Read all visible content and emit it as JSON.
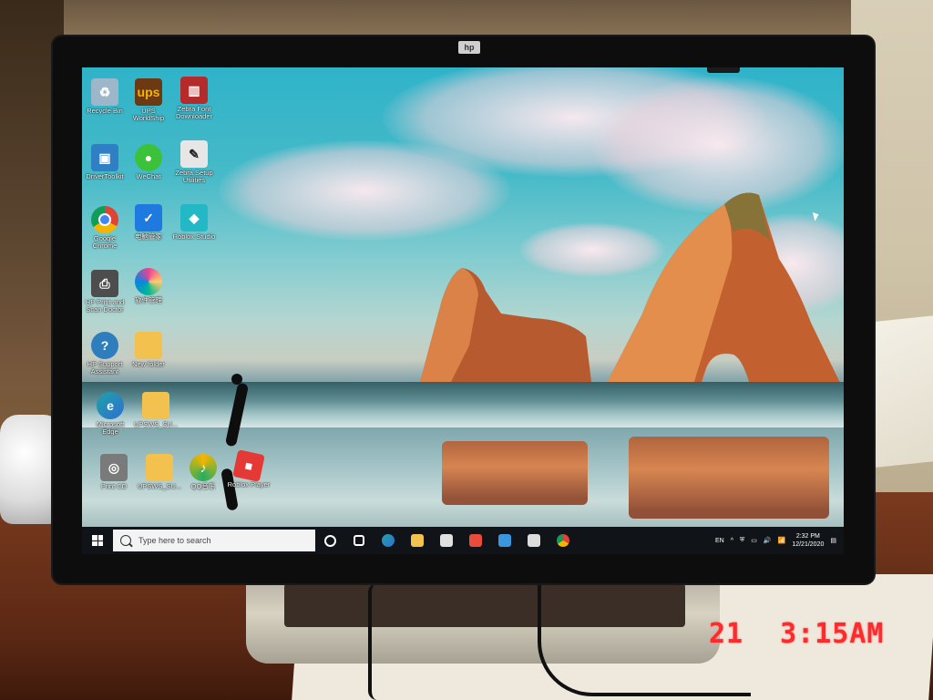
{
  "monitor": {
    "brand": "hp"
  },
  "photo_overlay": {
    "date_fragment": "21",
    "time": "3:15AM"
  },
  "desktop_icons": [
    {
      "label": "Recycle Bin",
      "icon": "recycle-bin-icon",
      "color": "#9bb7c9"
    },
    {
      "label": "UPS WorldShip",
      "icon": "ups-icon",
      "color": "#6b3a12"
    },
    {
      "label": "Zebra Font Downloader",
      "icon": "zebra-font-icon",
      "color": "#b52a2a"
    },
    {
      "label": "DriverToolkit",
      "icon": "driver-toolkit-icon",
      "color": "#2f7fc4"
    },
    {
      "label": "WeChat",
      "icon": "wechat-icon",
      "color": "#3cc13b"
    },
    {
      "label": "Zebra Setup Utilities",
      "icon": "zebra-setup-icon",
      "color": "#e6e6e6"
    },
    {
      "label": "Google Chrome",
      "icon": "chrome-icon",
      "color": "#db4437"
    },
    {
      "label": "电脑管家",
      "icon": "pc-manager-icon",
      "color": "#1f7ae0"
    },
    {
      "label": "Roblox Studio",
      "icon": "roblox-studio-icon",
      "color": "#22b8c6"
    },
    {
      "label": "HP Print and Scan Doctor",
      "icon": "hp-print-doctor-icon",
      "color": "#4d4d4d"
    },
    {
      "label": "软件管理",
      "icon": "software-manager-icon",
      "color": "#e84393"
    },
    {
      "label": "HP Support Assistant",
      "icon": "hp-support-icon",
      "color": "#2e7dbd"
    },
    {
      "label": "New folder",
      "icon": "folder-icon",
      "color": "#f2c14e"
    },
    {
      "label": "Microsoft Edge",
      "icon": "edge-icon",
      "color": "#1fa2a8"
    },
    {
      "label": "UPSWS_SU...",
      "icon": "file-icon",
      "color": "#f2c14e"
    },
    {
      "label": "Print CD",
      "icon": "print-cd-icon",
      "color": "#7a7a7a"
    },
    {
      "label": "UPSWS_SU...",
      "icon": "file-icon",
      "color": "#f2c14e"
    },
    {
      "label": "QQ音乐",
      "icon": "qq-music-icon",
      "color": "#f7b500"
    },
    {
      "label": "Roblox Player",
      "icon": "roblox-player-icon",
      "color": "#e53935"
    }
  ],
  "taskbar": {
    "search_placeholder": "Type here to search",
    "apps": [
      {
        "icon": "cortana-icon",
        "color": "#ffffff"
      },
      {
        "icon": "task-view-icon",
        "color": "#ffffff"
      },
      {
        "icon": "edge-icon",
        "color": "#1fa2a8"
      },
      {
        "icon": "file-explorer-icon",
        "color": "#f2c14e"
      },
      {
        "icon": "store-icon",
        "color": "#e0e0e0"
      },
      {
        "icon": "media-icon",
        "color": "#e74c3c"
      },
      {
        "icon": "mail-icon",
        "color": "#3a96dd"
      },
      {
        "icon": "app-icon",
        "color": "#dcdcdc"
      },
      {
        "icon": "chrome-icon",
        "color": "#db4437"
      }
    ],
    "language": "EN",
    "time": "2:32 PM",
    "date": "12/21/2020"
  }
}
